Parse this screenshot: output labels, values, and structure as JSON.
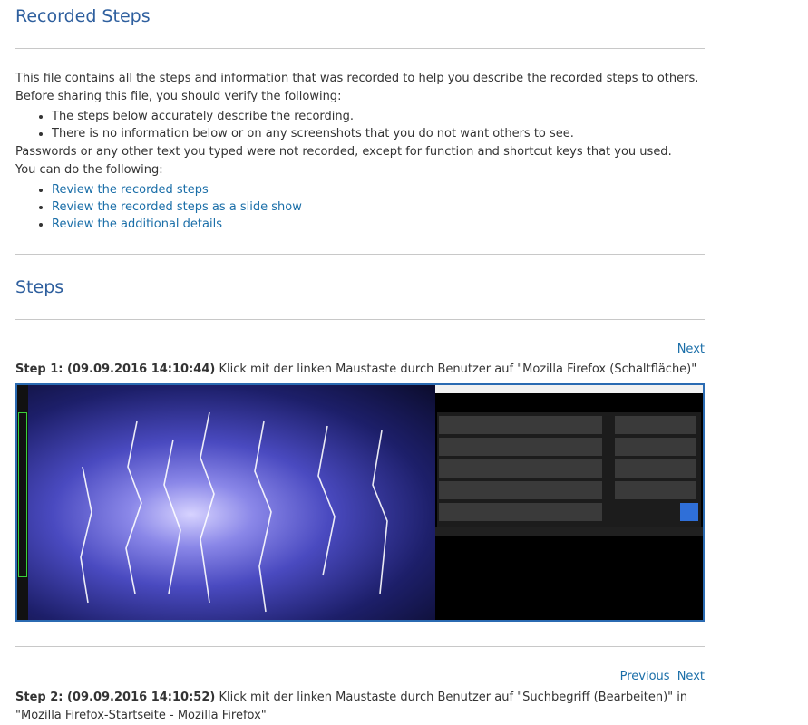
{
  "page": {
    "title": "Recorded Steps",
    "intro_line1": "This file contains all the steps and information that was recorded to help you describe the recorded steps to others.",
    "intro_line2": "Before sharing this file, you should verify the following:",
    "verify_items": [
      "The steps below accurately describe the recording.",
      "There is no information below or on any screenshots that you do not want others to see."
    ],
    "intro_line3": "Passwords or any other text you typed were not recorded, except for function and shortcut keys that you used.",
    "intro_line4": "You can do the following:",
    "links": [
      "Review the recorded steps",
      "Review the recorded steps as a slide show",
      "Review the additional details"
    ],
    "steps_heading": "Steps"
  },
  "steps": [
    {
      "nav_next": "Next",
      "label": "Step 1: (09.09.2016 14:10:44)",
      "text": "Klick mit der linken Maustaste durch Benutzer auf \"Mozilla Firefox (Schaltfläche)\""
    },
    {
      "nav_prev": "Previous",
      "nav_next": "Next",
      "label": "Step 2: (09.09.2016 14:10:52)",
      "text": "Klick mit der linken Maustaste durch Benutzer auf \"Suchbegriff (Bearbeiten)\" in \"Mozilla Firefox-Startseite - Mozilla Firefox\""
    }
  ]
}
